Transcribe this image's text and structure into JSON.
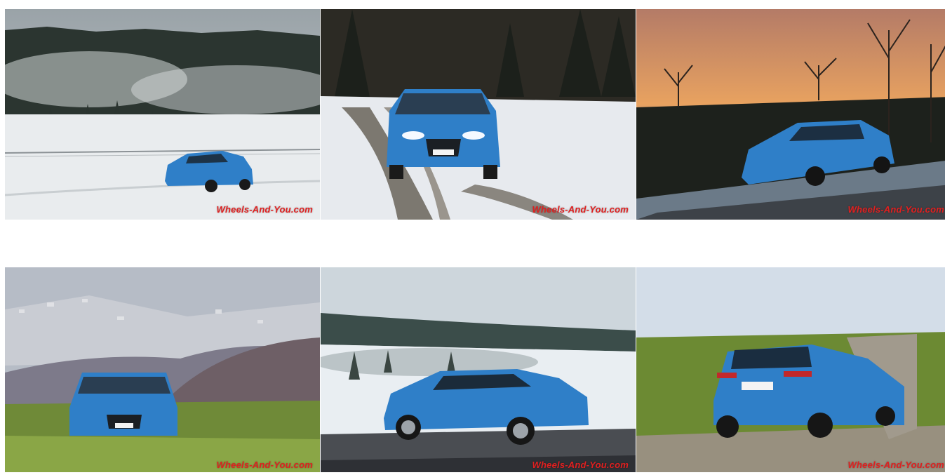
{
  "gallery": {
    "watermark": "Wheels-And-You.com",
    "photos": [
      {
        "subject": "blue-nissan-qashqai",
        "scene": "snowy field with fog and pine forest"
      },
      {
        "subject": "blue-nissan-qashqai",
        "scene": "front view on snowy track with headlights on"
      },
      {
        "subject": "blue-nissan-qashqai",
        "scene": "sunset over forest, car on wet road"
      },
      {
        "subject": "blue-nissan-qashqai",
        "scene": "front view on green meadow with village behind"
      },
      {
        "subject": "blue-nissan-qashqai",
        "scene": "side view in misty snowy landscape"
      },
      {
        "subject": "blue-nissan-qashqai",
        "scene": "rear view on gravel track in meadow"
      }
    ]
  },
  "colors": {
    "car_blue": "#2f7fc8",
    "watermark_red": "#e02020",
    "background": "#ffffff"
  }
}
